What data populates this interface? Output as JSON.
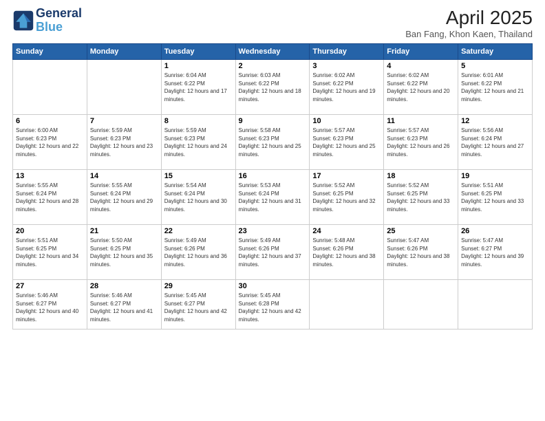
{
  "header": {
    "logo_line1": "General",
    "logo_line2": "Blue",
    "title": "April 2025",
    "subtitle": "Ban Fang, Khon Kaen, Thailand"
  },
  "weekdays": [
    "Sunday",
    "Monday",
    "Tuesday",
    "Wednesday",
    "Thursday",
    "Friday",
    "Saturday"
  ],
  "weeks": [
    [
      {
        "day": "",
        "info": ""
      },
      {
        "day": "",
        "info": ""
      },
      {
        "day": "1",
        "info": "Sunrise: 6:04 AM\nSunset: 6:22 PM\nDaylight: 12 hours and 17 minutes."
      },
      {
        "day": "2",
        "info": "Sunrise: 6:03 AM\nSunset: 6:22 PM\nDaylight: 12 hours and 18 minutes."
      },
      {
        "day": "3",
        "info": "Sunrise: 6:02 AM\nSunset: 6:22 PM\nDaylight: 12 hours and 19 minutes."
      },
      {
        "day": "4",
        "info": "Sunrise: 6:02 AM\nSunset: 6:22 PM\nDaylight: 12 hours and 20 minutes."
      },
      {
        "day": "5",
        "info": "Sunrise: 6:01 AM\nSunset: 6:22 PM\nDaylight: 12 hours and 21 minutes."
      }
    ],
    [
      {
        "day": "6",
        "info": "Sunrise: 6:00 AM\nSunset: 6:23 PM\nDaylight: 12 hours and 22 minutes."
      },
      {
        "day": "7",
        "info": "Sunrise: 5:59 AM\nSunset: 6:23 PM\nDaylight: 12 hours and 23 minutes."
      },
      {
        "day": "8",
        "info": "Sunrise: 5:59 AM\nSunset: 6:23 PM\nDaylight: 12 hours and 24 minutes."
      },
      {
        "day": "9",
        "info": "Sunrise: 5:58 AM\nSunset: 6:23 PM\nDaylight: 12 hours and 25 minutes."
      },
      {
        "day": "10",
        "info": "Sunrise: 5:57 AM\nSunset: 6:23 PM\nDaylight: 12 hours and 25 minutes."
      },
      {
        "day": "11",
        "info": "Sunrise: 5:57 AM\nSunset: 6:23 PM\nDaylight: 12 hours and 26 minutes."
      },
      {
        "day": "12",
        "info": "Sunrise: 5:56 AM\nSunset: 6:24 PM\nDaylight: 12 hours and 27 minutes."
      }
    ],
    [
      {
        "day": "13",
        "info": "Sunrise: 5:55 AM\nSunset: 6:24 PM\nDaylight: 12 hours and 28 minutes."
      },
      {
        "day": "14",
        "info": "Sunrise: 5:55 AM\nSunset: 6:24 PM\nDaylight: 12 hours and 29 minutes."
      },
      {
        "day": "15",
        "info": "Sunrise: 5:54 AM\nSunset: 6:24 PM\nDaylight: 12 hours and 30 minutes."
      },
      {
        "day": "16",
        "info": "Sunrise: 5:53 AM\nSunset: 6:24 PM\nDaylight: 12 hours and 31 minutes."
      },
      {
        "day": "17",
        "info": "Sunrise: 5:52 AM\nSunset: 6:25 PM\nDaylight: 12 hours and 32 minutes."
      },
      {
        "day": "18",
        "info": "Sunrise: 5:52 AM\nSunset: 6:25 PM\nDaylight: 12 hours and 33 minutes."
      },
      {
        "day": "19",
        "info": "Sunrise: 5:51 AM\nSunset: 6:25 PM\nDaylight: 12 hours and 33 minutes."
      }
    ],
    [
      {
        "day": "20",
        "info": "Sunrise: 5:51 AM\nSunset: 6:25 PM\nDaylight: 12 hours and 34 minutes."
      },
      {
        "day": "21",
        "info": "Sunrise: 5:50 AM\nSunset: 6:25 PM\nDaylight: 12 hours and 35 minutes."
      },
      {
        "day": "22",
        "info": "Sunrise: 5:49 AM\nSunset: 6:26 PM\nDaylight: 12 hours and 36 minutes."
      },
      {
        "day": "23",
        "info": "Sunrise: 5:49 AM\nSunset: 6:26 PM\nDaylight: 12 hours and 37 minutes."
      },
      {
        "day": "24",
        "info": "Sunrise: 5:48 AM\nSunset: 6:26 PM\nDaylight: 12 hours and 38 minutes."
      },
      {
        "day": "25",
        "info": "Sunrise: 5:47 AM\nSunset: 6:26 PM\nDaylight: 12 hours and 38 minutes."
      },
      {
        "day": "26",
        "info": "Sunrise: 5:47 AM\nSunset: 6:27 PM\nDaylight: 12 hours and 39 minutes."
      }
    ],
    [
      {
        "day": "27",
        "info": "Sunrise: 5:46 AM\nSunset: 6:27 PM\nDaylight: 12 hours and 40 minutes."
      },
      {
        "day": "28",
        "info": "Sunrise: 5:46 AM\nSunset: 6:27 PM\nDaylight: 12 hours and 41 minutes."
      },
      {
        "day": "29",
        "info": "Sunrise: 5:45 AM\nSunset: 6:27 PM\nDaylight: 12 hours and 42 minutes."
      },
      {
        "day": "30",
        "info": "Sunrise: 5:45 AM\nSunset: 6:28 PM\nDaylight: 12 hours and 42 minutes."
      },
      {
        "day": "",
        "info": ""
      },
      {
        "day": "",
        "info": ""
      },
      {
        "day": "",
        "info": ""
      }
    ]
  ]
}
